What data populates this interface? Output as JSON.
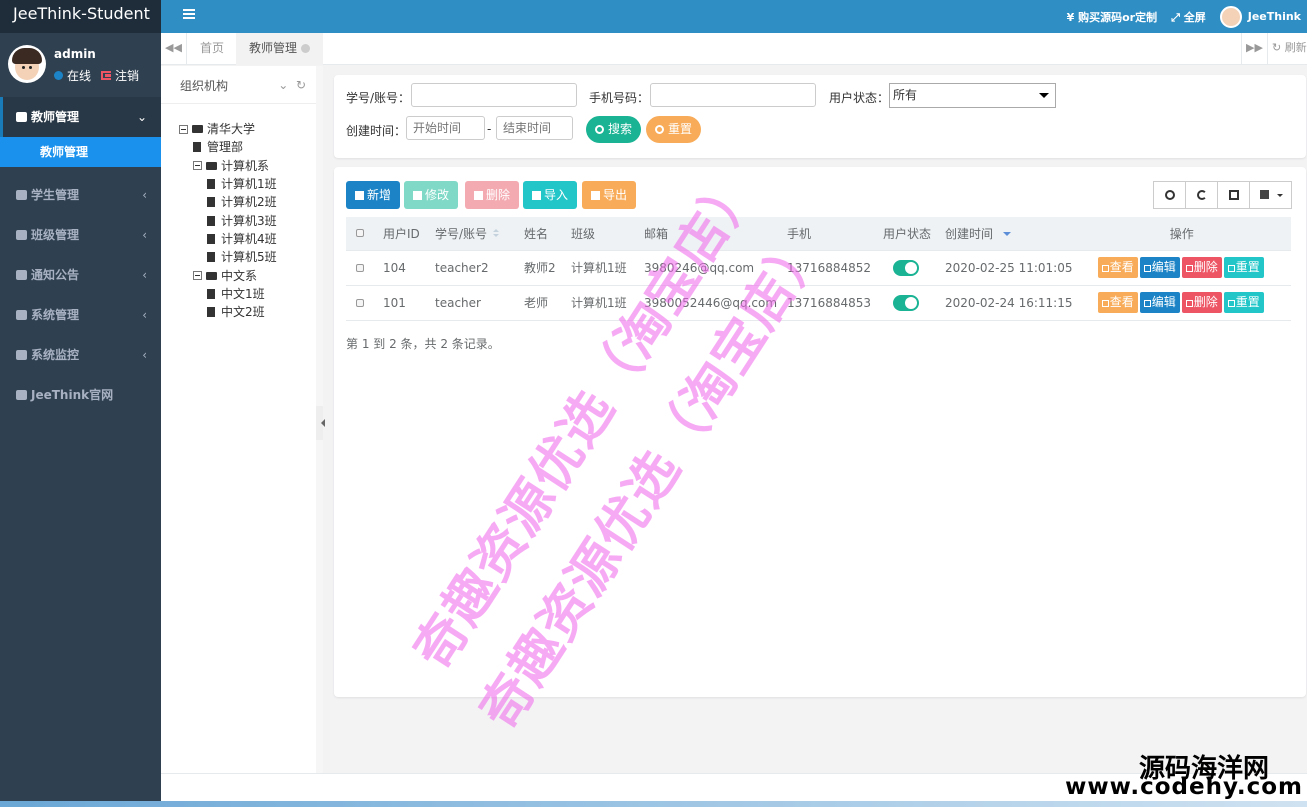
{
  "app": {
    "brand": "JeeThink-Student"
  },
  "user": {
    "name": "admin",
    "status": "在线",
    "logout": "注销"
  },
  "sidebar": {
    "items": [
      {
        "label": "教师管理",
        "active": true
      },
      {
        "label": "学生管理"
      },
      {
        "label": "班级管理"
      },
      {
        "label": "通知公告"
      },
      {
        "label": "系统管理"
      },
      {
        "label": "系统监控"
      },
      {
        "label": "JeeThink官网"
      }
    ],
    "submenu": {
      "label": "教师管理"
    }
  },
  "topbar": {
    "buy": "¥ 购买源码or定制",
    "fullscreen": "全屏",
    "username": "JeeThink"
  },
  "tabs": {
    "home": "首页",
    "active": "教师管理",
    "refresh": "刷新"
  },
  "tree": {
    "title": "组织机构",
    "nodes": [
      {
        "label": "清华大学",
        "level": 0,
        "type": "folder"
      },
      {
        "label": "管理部",
        "level": 1,
        "type": "file"
      },
      {
        "label": "计算机系",
        "level": 1,
        "type": "folder"
      },
      {
        "label": "计算机1班",
        "level": 2,
        "type": "file"
      },
      {
        "label": "计算机2班",
        "level": 2,
        "type": "file"
      },
      {
        "label": "计算机3班",
        "level": 2,
        "type": "file"
      },
      {
        "label": "计算机4班",
        "level": 2,
        "type": "file"
      },
      {
        "label": "计算机5班",
        "level": 2,
        "type": "file"
      },
      {
        "label": "中文系",
        "level": 1,
        "type": "folder"
      },
      {
        "label": "中文1班",
        "level": 2,
        "type": "file"
      },
      {
        "label": "中文2班",
        "level": 2,
        "type": "file"
      }
    ]
  },
  "search": {
    "account_label": "学号/账号：",
    "phone_label": "手机号码：",
    "status_label": "用户状态：",
    "status_value": "所有",
    "created_label": "创建时间：",
    "start_placeholder": "开始时间",
    "separator": "-",
    "end_placeholder": "结束时间",
    "search_btn": "搜索",
    "reset_btn": "重置"
  },
  "toolbar": {
    "add": "新增",
    "edit": "修改",
    "delete": "删除",
    "import": "导入",
    "export": "导出"
  },
  "table": {
    "headers": [
      "用户ID",
      "学号/账号",
      "姓名",
      "班级",
      "邮箱",
      "手机",
      "用户状态",
      "创建时间",
      "操作"
    ],
    "rows": [
      {
        "id": "104",
        "account": "teacher2",
        "name": "教师2",
        "class": "计算机1班",
        "email": "3980246@qq.com",
        "phone": "13716884852",
        "enabled": true,
        "created": "2020-02-25 11:01:05"
      },
      {
        "id": "101",
        "account": "teacher",
        "name": "老师",
        "class": "计算机1班",
        "email": "3980052446@qq.com",
        "phone": "13716884853",
        "enabled": true,
        "created": "2020-02-24 16:11:15"
      }
    ],
    "actions": {
      "view": "查看",
      "edit": "编辑",
      "delete": "删除",
      "reset": "重置"
    },
    "pagination": "第 1 到 2 条，共 2 条记录。"
  },
  "watermark": {
    "line1": "奇趣资源优选（淘宝店）",
    "line2": "奇趣资源优选（淘宝店）"
  },
  "corner_logo": {
    "title": "源码海洋网",
    "url": "www.codehy.com"
  },
  "colors": {
    "sidebar": "#2f4050",
    "topbar": "#2f8ec4",
    "primary": "#1c84c6",
    "success": "#1ab394",
    "warning": "#f8ac59",
    "danger": "#ed5565",
    "info": "#23c6c8"
  }
}
